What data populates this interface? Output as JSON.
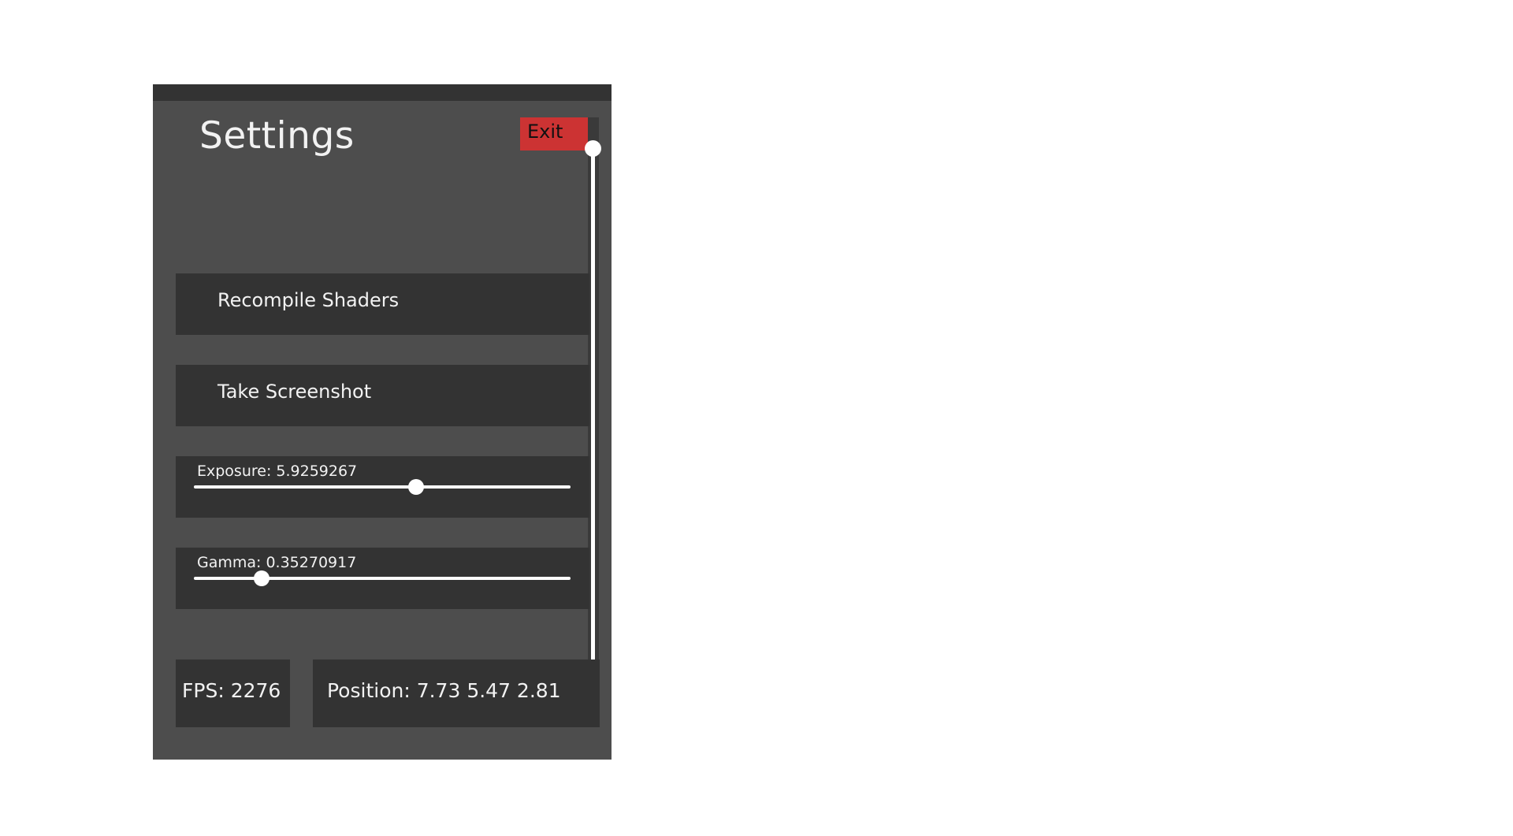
{
  "settings": {
    "title": "Settings",
    "exit_label": "Exit",
    "buttons": {
      "recompile_label": "Recompile Shaders",
      "screenshot_label": "Take Screenshot"
    },
    "exposure": {
      "label": "Exposure: 5.9259267",
      "position": 0.59
    },
    "gamma": {
      "label": "Gamma: 0.35270917",
      "position": 0.18
    },
    "stats": {
      "fps": "FPS: 2276",
      "position": "Position: 7.73 5.47 2.81"
    },
    "scroll_position": 0.0,
    "colors": {
      "panel": "#4d4d4d",
      "dark": "#333333",
      "exit": "#cc3333",
      "text": "#f2f2f2"
    }
  }
}
